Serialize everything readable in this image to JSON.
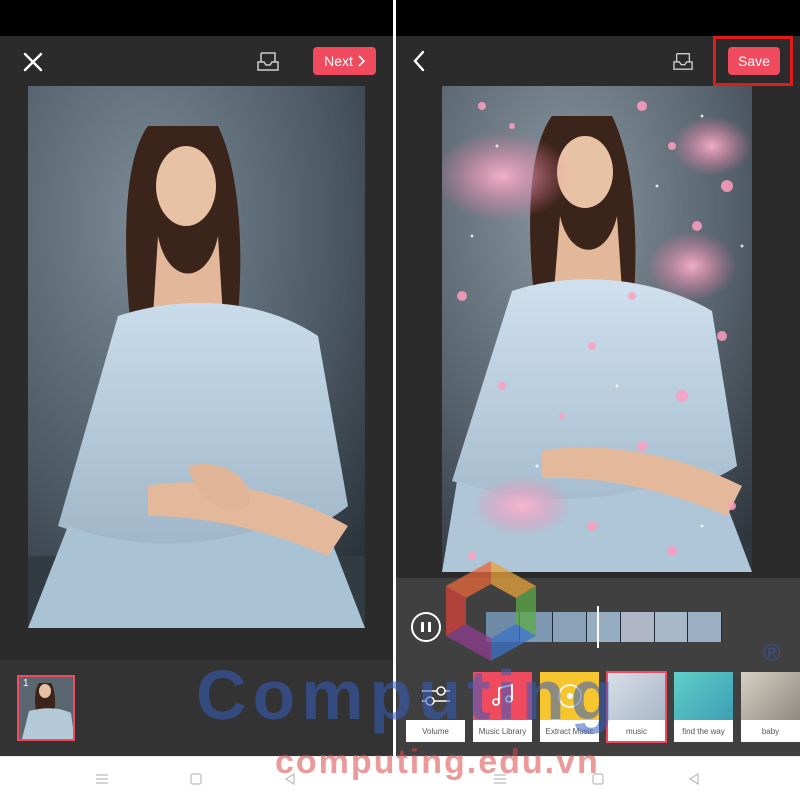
{
  "left_screen": {
    "header": {
      "next_label": "Next"
    },
    "thumbnail_number": "1"
  },
  "right_screen": {
    "header": {
      "save_label": "Save"
    },
    "music_tiles": [
      {
        "label": "Volume",
        "icon": "sliders-icon"
      },
      {
        "label": "Music Library",
        "icon": "music-note-icon"
      },
      {
        "label": "Extract Music",
        "icon": "disc-icon"
      },
      {
        "label": "music",
        "icon": "album-art"
      },
      {
        "label": "find the way",
        "icon": "album-art"
      },
      {
        "label": "baby",
        "icon": "album-art"
      }
    ]
  },
  "watermark": {
    "brand": "Computing",
    "url": "computing.edu.vn",
    "registered": "®"
  },
  "colors": {
    "accent": "#ef4a5e",
    "highlight": "#e21a1a",
    "app_bg": "#2b2b2b"
  }
}
